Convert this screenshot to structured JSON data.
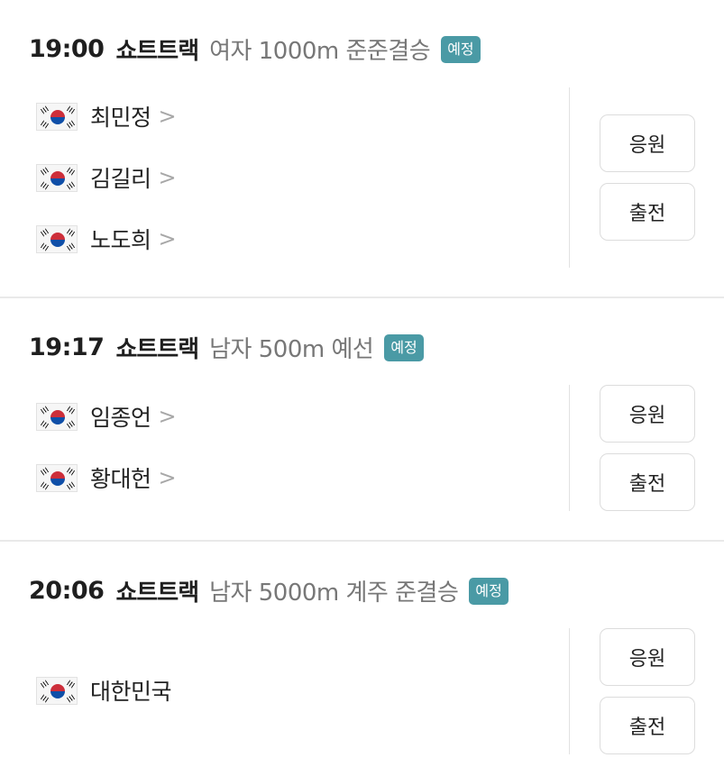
{
  "events": [
    {
      "time": "19:00",
      "sport": "쇼트트랙",
      "event": "여자 1000m 준준결승",
      "status": "예정",
      "athletes": [
        {
          "name": "최민정",
          "flag_icon": "korea-flag-icon",
          "link": true
        },
        {
          "name": "김길리",
          "flag_icon": "korea-flag-icon",
          "link": true
        },
        {
          "name": "노도희",
          "flag_icon": "korea-flag-icon",
          "link": true
        }
      ],
      "cheer_label": "응원",
      "entry_label": "출전"
    },
    {
      "time": "19:17",
      "sport": "쇼트트랙",
      "event": "남자 500m 예선",
      "status": "예정",
      "athletes": [
        {
          "name": "임종언",
          "flag_icon": "korea-flag-icon",
          "link": true
        },
        {
          "name": "황대헌",
          "flag_icon": "korea-flag-icon",
          "link": true
        }
      ],
      "cheer_label": "응원",
      "entry_label": "출전"
    },
    {
      "time": "20:06",
      "sport": "쇼트트랙",
      "event": "남자 5000m 계주 준결승",
      "status": "예정",
      "athletes": [
        {
          "name": "대한민국",
          "flag_icon": "korea-flag-icon",
          "link": false
        }
      ],
      "cheer_label": "응원",
      "entry_label": "출전"
    }
  ],
  "chevron_glyph": ">",
  "colors": {
    "badge": "#4a9aa5",
    "event_text": "#777777",
    "divider": "#e2e2e2"
  }
}
